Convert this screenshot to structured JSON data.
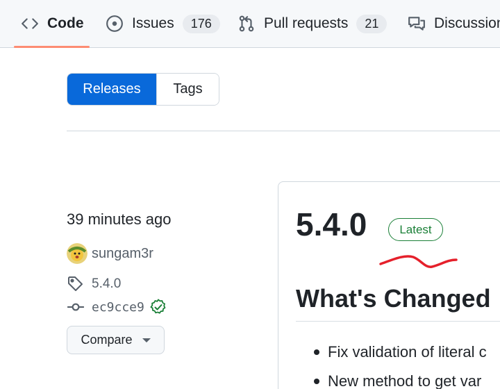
{
  "nav": {
    "tabs": [
      {
        "label": "Code",
        "icon": "code-icon"
      },
      {
        "label": "Issues",
        "icon": "issue-opened-icon",
        "count": "176"
      },
      {
        "label": "Pull requests",
        "icon": "git-pull-request-icon",
        "count": "21"
      },
      {
        "label": "Discussions",
        "icon": "comment-discussion-icon"
      }
    ]
  },
  "segmented": {
    "releases_label": "Releases",
    "tags_label": "Tags"
  },
  "release": {
    "time": "39 minutes ago",
    "author": "sungam3r",
    "tag": "5.4.0",
    "commit": "ec9cce9",
    "compare_label": "Compare",
    "version_title": "5.4.0",
    "latest_badge": "Latest",
    "section_heading": "What's Changed",
    "items": [
      "Fix validation of literal c",
      "New method to get var"
    ]
  },
  "colors": {
    "accent_blue": "#0969da",
    "latest_green": "#1a7f37",
    "tab_underline": "#fd8c73",
    "annotation_red": "#e5202b"
  }
}
